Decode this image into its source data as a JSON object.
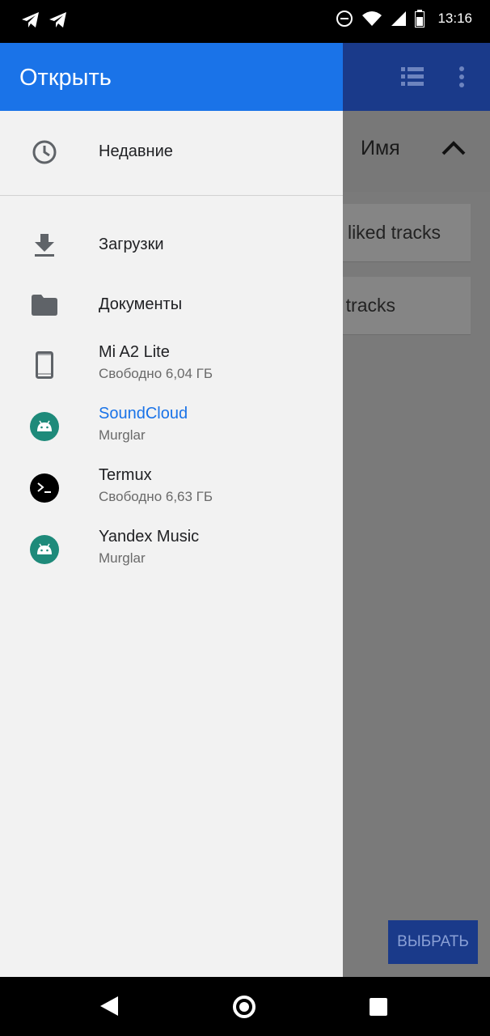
{
  "status_bar": {
    "time": "13:16",
    "icons": [
      "telegram-icon",
      "telegram-icon",
      "dnd-icon",
      "wifi-icon",
      "signal-icon",
      "battery-icon"
    ]
  },
  "background": {
    "toolbar_icons": [
      "view-list-icon",
      "more-vert-icon"
    ],
    "sort_label": "Имя",
    "items": [
      "liked tracks",
      "tracks"
    ],
    "select_button": "ВЫБРАТЬ"
  },
  "drawer": {
    "title": "Открыть",
    "recent": {
      "title": "Недавние",
      "icon": "history-icon"
    },
    "roots": [
      {
        "title": "Загрузки",
        "icon": "download-icon"
      },
      {
        "title": "Документы",
        "icon": "folder-icon"
      },
      {
        "title": "Mi A2 Lite",
        "summary": "Свободно 6,04 ГБ",
        "icon": "phone-icon"
      },
      {
        "title": "SoundCloud",
        "summary": "Murglar",
        "icon": "android-icon"
      },
      {
        "title": "Termux",
        "summary": "Свободно 6,63 ГБ",
        "icon": "termux-icon"
      },
      {
        "title": "Yandex Music",
        "summary": "Murglar",
        "icon": "android-icon"
      }
    ],
    "accent_color": "#1a73e8"
  },
  "nav_bar": {
    "buttons": [
      "back-icon",
      "home-icon",
      "recents-icon"
    ]
  }
}
